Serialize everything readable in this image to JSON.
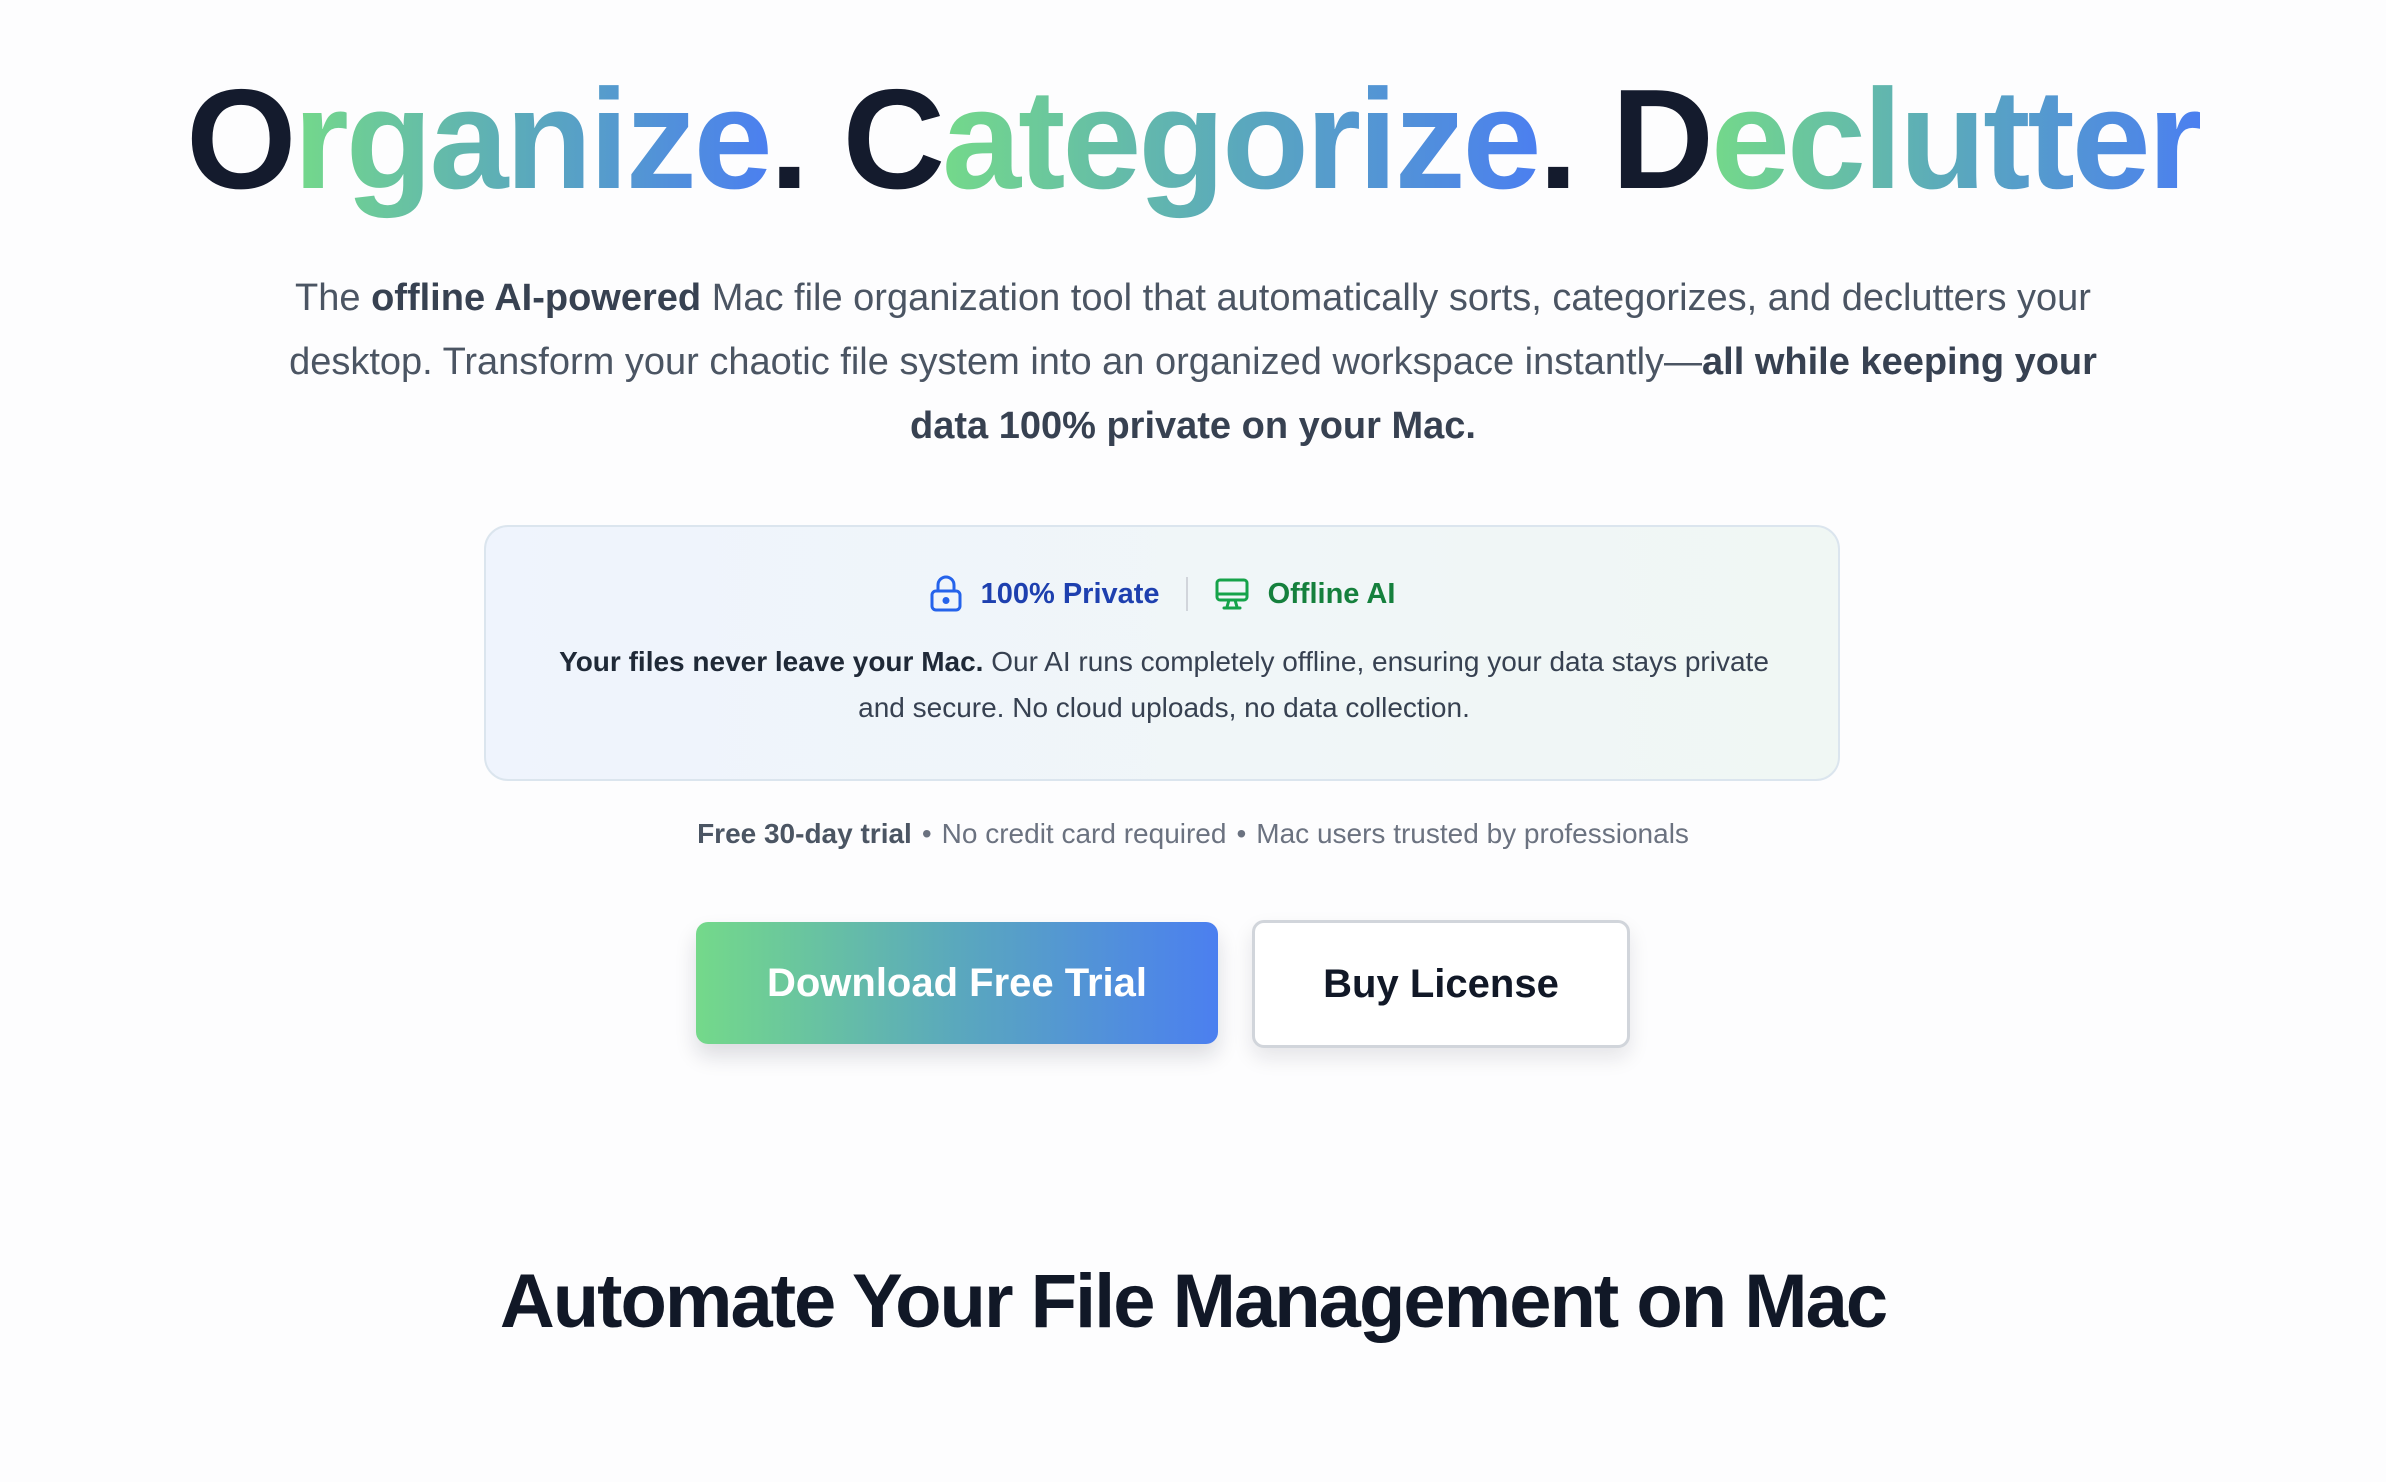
{
  "hero": {
    "title_parts": {
      "o": "O",
      "rganize": "rganize",
      "dot1": ". ",
      "c": "C",
      "ategorize": "ategorize",
      "dot2": ". ",
      "d": "D",
      "eclutter": "eclutter"
    },
    "subtitle": {
      "part1": "The ",
      "bold1": "offline AI-powered",
      "part2": " Mac file organization tool that automatically sorts, categorizes, and declutters your desktop. Transform your chaotic file system into an organized workspace instantly—",
      "bold2": "all while keeping your data 100% private on your Mac."
    }
  },
  "privacy": {
    "badge_private": "100% Private",
    "badge_offline": "Offline AI",
    "text_bold": "Your files never leave your Mac.",
    "text_rest": " Our AI runs completely offline, ensuring your data stays private and secure. No cloud uploads, no data collection."
  },
  "trial": {
    "bold": "Free 30-day trial",
    "sep": "•",
    "item2": "No credit card required",
    "item3": "Mac users trusted by professionals"
  },
  "buttons": {
    "primary": "Download Free Trial",
    "secondary": "Buy License"
  },
  "section": {
    "heading": "Automate Your File Management on Mac"
  },
  "colors": {
    "gradient_start": "#74d98a",
    "gradient_mid": "#5aa8bd",
    "gradient_end": "#4b7ff0",
    "private_blue": "#1e40af",
    "offline_green": "#15803d",
    "title_dark": "#141b2d"
  },
  "icons": {
    "private": "lock-icon",
    "offline": "monitor-icon"
  }
}
